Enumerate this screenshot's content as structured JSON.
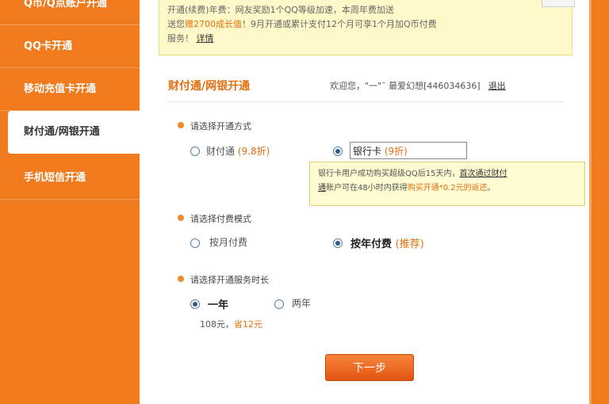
{
  "sidebar": {
    "items": [
      {
        "label": "Q币/Q点账户开通"
      },
      {
        "label": "QQ卡开通"
      },
      {
        "label": "移动充值卡开通"
      },
      {
        "label": "财付通/网银开通"
      },
      {
        "label": "手机短信开通"
      }
    ]
  },
  "notice": {
    "line1": "开通(续费)年费：网友奖励1个QQ等级加速，本周年费加送",
    "line2a": "送您",
    "line2b": "赠2700成长值",
    "line2c": "！9月开通或累计支付12个月",
    "line2d": "可享1个月加Q币付费",
    "line3": "服务！",
    "link": "详情"
  },
  "section": {
    "title": "财付通/网银开通",
    "welcome_prefix": "欢迎您，",
    "username": "\"一\"ˉ 最爱幻想[446034636]",
    "logout": "退出"
  },
  "method": {
    "heading": "请选择开通方式",
    "opt1_label": "财付通",
    "opt1_price": "(9.8折)",
    "opt2_label": "银行卡",
    "opt2_price": "(9折)"
  },
  "tooltip": {
    "t1": "银行卡用户成功购买超级QQ后15天内，",
    "link1": "首次通过财付",
    "link2": "通",
    "t2": "账户可在48小时内获得",
    "hl": "购买开通*0.2元的返还",
    "t3": "。"
  },
  "payment": {
    "heading": "请选择付费模式",
    "opt1_label": "按月付费",
    "opt2_label": "按年付费",
    "opt2_tag": "(推荐)"
  },
  "duration": {
    "heading": "请选择开通服务时长",
    "opt1_label": "一年",
    "opt2_label": "两年",
    "price_text": "108元，",
    "save_text": "省12元"
  },
  "next_label": "下一步"
}
